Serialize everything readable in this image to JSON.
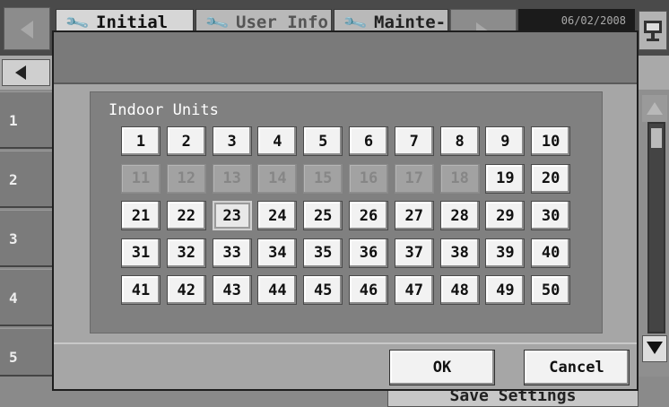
{
  "header": {
    "tabs": [
      {
        "label": "Initial",
        "icon": "wrench-icon"
      },
      {
        "label": "User Info",
        "icon": "wrench-icon"
      },
      {
        "label": "Mainte-",
        "icon": "wrench-icon"
      }
    ],
    "date": "06/02/2008"
  },
  "sidebar": {
    "rows": [
      "1",
      "2",
      "3",
      "4",
      "5"
    ]
  },
  "footer": {
    "save_label": "Save Settings"
  },
  "dialog": {
    "title": "Indoor Units",
    "units": [
      {
        "label": "1",
        "state": "enabled"
      },
      {
        "label": "2",
        "state": "enabled"
      },
      {
        "label": "3",
        "state": "enabled"
      },
      {
        "label": "4",
        "state": "enabled"
      },
      {
        "label": "5",
        "state": "enabled"
      },
      {
        "label": "6",
        "state": "enabled"
      },
      {
        "label": "7",
        "state": "enabled"
      },
      {
        "label": "8",
        "state": "enabled"
      },
      {
        "label": "9",
        "state": "enabled"
      },
      {
        "label": "10",
        "state": "enabled"
      },
      {
        "label": "11",
        "state": "disabled"
      },
      {
        "label": "12",
        "state": "disabled"
      },
      {
        "label": "13",
        "state": "disabled"
      },
      {
        "label": "14",
        "state": "disabled"
      },
      {
        "label": "15",
        "state": "disabled"
      },
      {
        "label": "16",
        "state": "disabled"
      },
      {
        "label": "17",
        "state": "disabled"
      },
      {
        "label": "18",
        "state": "disabled"
      },
      {
        "label": "19",
        "state": "enabled"
      },
      {
        "label": "20",
        "state": "enabled"
      },
      {
        "label": "21",
        "state": "enabled"
      },
      {
        "label": "22",
        "state": "enabled"
      },
      {
        "label": "23",
        "state": "selected"
      },
      {
        "label": "24",
        "state": "enabled"
      },
      {
        "label": "25",
        "state": "enabled"
      },
      {
        "label": "26",
        "state": "enabled"
      },
      {
        "label": "27",
        "state": "enabled"
      },
      {
        "label": "28",
        "state": "enabled"
      },
      {
        "label": "29",
        "state": "enabled"
      },
      {
        "label": "30",
        "state": "enabled"
      },
      {
        "label": "31",
        "state": "enabled"
      },
      {
        "label": "32",
        "state": "enabled"
      },
      {
        "label": "33",
        "state": "enabled"
      },
      {
        "label": "34",
        "state": "enabled"
      },
      {
        "label": "35",
        "state": "enabled"
      },
      {
        "label": "36",
        "state": "enabled"
      },
      {
        "label": "37",
        "state": "enabled"
      },
      {
        "label": "38",
        "state": "enabled"
      },
      {
        "label": "39",
        "state": "enabled"
      },
      {
        "label": "40",
        "state": "enabled"
      },
      {
        "label": "41",
        "state": "enabled"
      },
      {
        "label": "42",
        "state": "enabled"
      },
      {
        "label": "43",
        "state": "enabled"
      },
      {
        "label": "44",
        "state": "enabled"
      },
      {
        "label": "45",
        "state": "enabled"
      },
      {
        "label": "46",
        "state": "enabled"
      },
      {
        "label": "47",
        "state": "enabled"
      },
      {
        "label": "48",
        "state": "enabled"
      },
      {
        "label": "49",
        "state": "enabled"
      },
      {
        "label": "50",
        "state": "enabled"
      }
    ],
    "ok_label": "OK",
    "cancel_label": "Cancel"
  },
  "colors": {
    "button_face": "#f2f2f2",
    "disabled_button": "#a2a2a2",
    "panel": "#808080",
    "dialog": "#a6a6a6"
  }
}
